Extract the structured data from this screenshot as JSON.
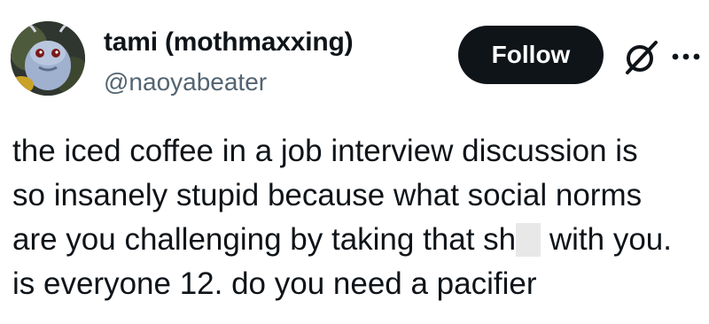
{
  "author": {
    "display_name": "tami (mothmaxxing)",
    "handle": "@naoyabeater",
    "avatar_icon": "bug-creature-avatar"
  },
  "actions": {
    "follow_label": "Follow",
    "grok_icon": "grok-icon",
    "more_icon": "more-icon"
  },
  "tweet": {
    "lines": [
      "the iced coffee in a job interview discussion is",
      "so insanely stupid because what social norms",
      "are you challenging by taking that sh",
      "is everyone 12. do you need a pacifier"
    ],
    "line3_tail": " with you.",
    "redacted": true
  },
  "colors": {
    "text": "#0f1419",
    "secondary": "#536471",
    "button_bg": "#0f1419",
    "button_text": "#ffffff",
    "censor": "#e8e8e8"
  }
}
